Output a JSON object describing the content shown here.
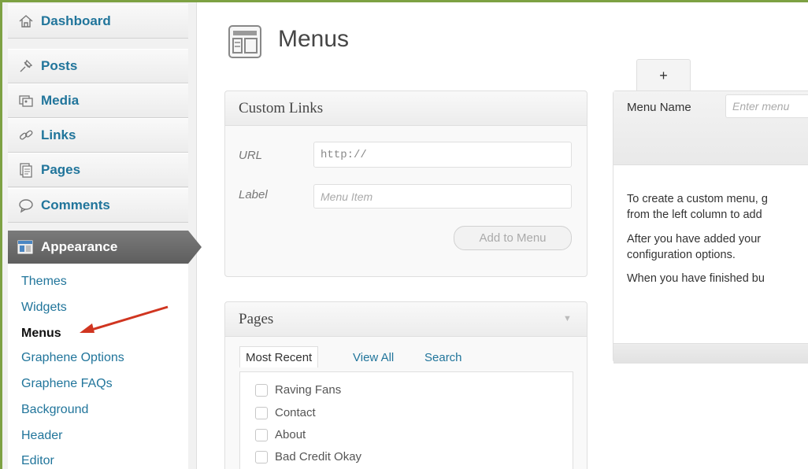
{
  "sidebar": {
    "items": [
      {
        "label": "Dashboard",
        "icon": "dashboard-icon"
      },
      {
        "label": "Posts",
        "icon": "pin-icon"
      },
      {
        "label": "Media",
        "icon": "media-icon"
      },
      {
        "label": "Links",
        "icon": "link-icon"
      },
      {
        "label": "Pages",
        "icon": "pages-icon"
      },
      {
        "label": "Comments",
        "icon": "comment-bubble-icon"
      }
    ],
    "appearance": {
      "label": "Appearance",
      "icon": "appearance-icon"
    },
    "submenu": [
      {
        "label": "Themes"
      },
      {
        "label": "Widgets"
      },
      {
        "label": "Menus",
        "current": true
      },
      {
        "label": "Graphene Options"
      },
      {
        "label": "Graphene FAQs"
      },
      {
        "label": "Background"
      },
      {
        "label": "Header"
      },
      {
        "label": "Editor"
      }
    ]
  },
  "page": {
    "title": "Menus",
    "icon": "menus-icon"
  },
  "custom_links": {
    "title": "Custom Links",
    "url_label": "URL",
    "url_value": "http://",
    "label_label": "Label",
    "label_placeholder": "Menu Item",
    "add_button": "Add to Menu"
  },
  "pages_box": {
    "title": "Pages",
    "tabs": [
      "Most Recent",
      "View All",
      "Search"
    ],
    "items": [
      "Raving Fans",
      "Contact",
      "About",
      "Bad Credit Okay"
    ]
  },
  "menu_editor": {
    "add_tab": "+",
    "menu_name_label": "Menu Name",
    "menu_name_placeholder": "Enter menu",
    "lines": [
      "To create a custom menu, g",
      "from the left column to add",
      "After you have added your",
      "configuration options.",
      "When you have finished bu"
    ]
  },
  "colors": {
    "link": "#21759b",
    "frame": "#7da143",
    "appearance_bg": "#6b6b6b",
    "annotation_arrow": "#d03520"
  }
}
